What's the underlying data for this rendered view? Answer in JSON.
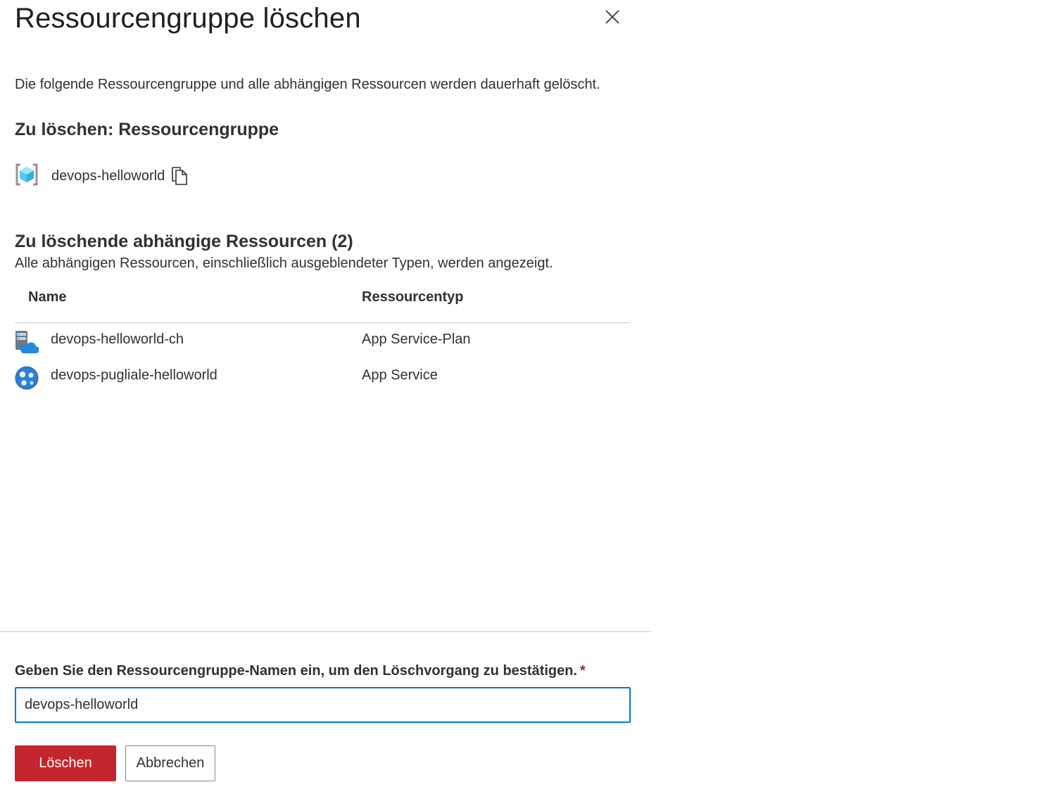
{
  "dialog": {
    "title": "Ressourcengruppe löschen",
    "description": "Die folgende Ressourcengruppe und alle abhängigen Ressourcen werden dauerhaft gelöscht."
  },
  "resource_group": {
    "heading": "Zu löschen: Ressourcengruppe",
    "name": "devops-helloworld",
    "icon": "resource-group-icon"
  },
  "dependents": {
    "heading": "Zu löschende abhängige Ressourcen (2)",
    "subtitle": "Alle abhängigen Ressourcen, einschließlich ausgeblendeter Typen, werden angezeigt.",
    "columns": [
      "Name",
      "Ressourcentyp"
    ],
    "rows": [
      {
        "name": "devops-helloworld-ch",
        "type": "App Service-Plan",
        "icon": "app-service-plan-icon"
      },
      {
        "name": "devops-pugliale-helloworld",
        "type": "App Service",
        "icon": "app-service-icon"
      }
    ]
  },
  "confirm": {
    "label": "Geben Sie den Ressourcengruppe-Namen ein, um den Löschvorgang zu bestätigen.",
    "required_marker": "*",
    "value": "devops-helloworld"
  },
  "buttons": {
    "delete": "Löschen",
    "cancel": "Abbrechen"
  },
  "colors": {
    "accent": "#0078d4",
    "danger": "#c4262e",
    "required": "#a4262c"
  }
}
